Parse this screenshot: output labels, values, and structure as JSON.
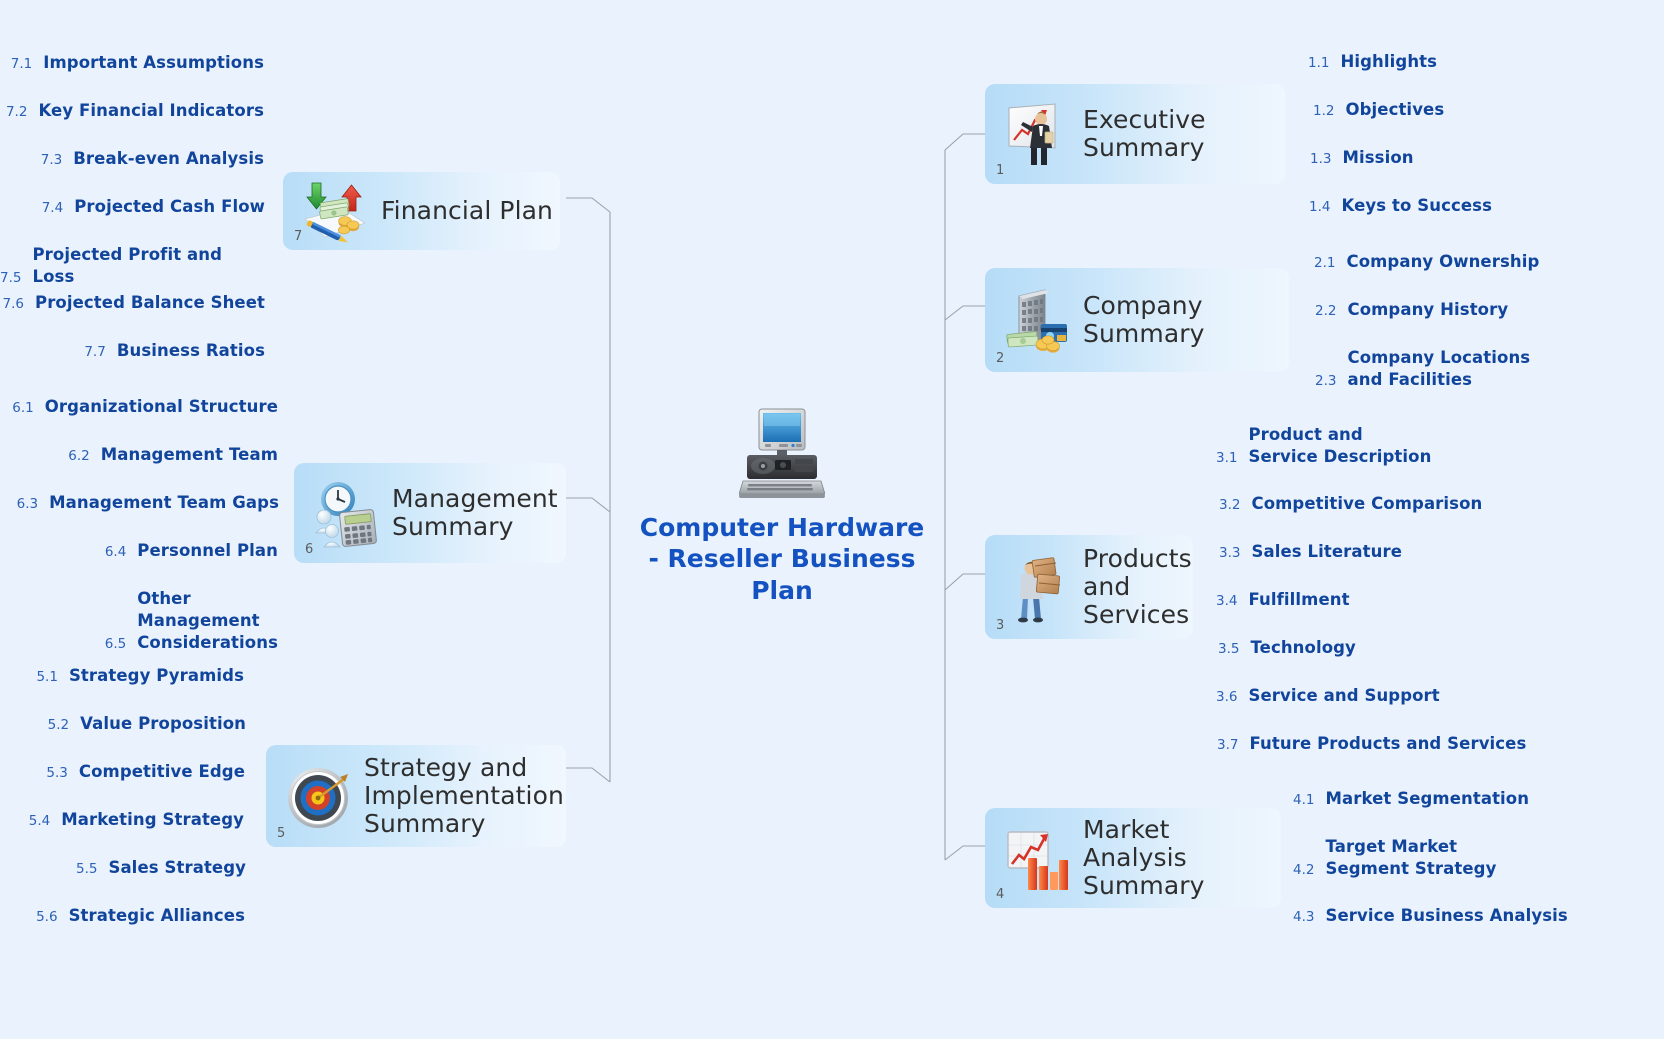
{
  "central": {
    "title": "Computer Hardware - Reseller Business Plan",
    "icon": "desktop-computer-icon"
  },
  "theme": {
    "background": "#eaf2fd",
    "central_title_color": "#1352c0",
    "node_label_color": "#2e2e2e",
    "subtopic_text_color": "#11459c",
    "subtopic_number_color": "#2d62b8",
    "connector_color": "#9aa2ab",
    "node_gradient_start": "#b5dcf7",
    "node_gradient_end": "#eef6fe"
  },
  "branches": [
    {
      "number": "1",
      "label": "Executive Summary",
      "icon": "presenter-chart-icon",
      "side": "right",
      "subtopics": [
        {
          "number": "1.1",
          "label": "Highlights"
        },
        {
          "number": "1.2",
          "label": "Objectives"
        },
        {
          "number": "1.3",
          "label": "Mission"
        },
        {
          "number": "1.4",
          "label": "Keys to Success"
        }
      ]
    },
    {
      "number": "2",
      "label": "Company Summary",
      "icon": "office-building-money-icon",
      "side": "right",
      "subtopics": [
        {
          "number": "2.1",
          "label": "Company Ownership"
        },
        {
          "number": "2.2",
          "label": "Company History"
        },
        {
          "number": "2.3",
          "label": "Company Locations and Facilities"
        }
      ]
    },
    {
      "number": "3",
      "label": "Products and Services",
      "icon": "person-carrying-boxes-icon",
      "side": "right",
      "subtopics": [
        {
          "number": "3.1",
          "label": "Product and Service Description"
        },
        {
          "number": "3.2",
          "label": "Competitive Comparison"
        },
        {
          "number": "3.3",
          "label": "Sales Literature"
        },
        {
          "number": "3.4",
          "label": "Fulfillment"
        },
        {
          "number": "3.5",
          "label": "Technology"
        },
        {
          "number": "3.6",
          "label": "Service and Support"
        },
        {
          "number": "3.7",
          "label": "Future Products and Services"
        }
      ]
    },
    {
      "number": "4",
      "label": "Market Analysis Summary",
      "icon": "bar-chart-growth-icon",
      "side": "right",
      "subtopics": [
        {
          "number": "4.1",
          "label": "Market Segmentation"
        },
        {
          "number": "4.2",
          "label": "Target Market Segment Strategy"
        },
        {
          "number": "4.3",
          "label": "Service Business Analysis"
        }
      ]
    },
    {
      "number": "5",
      "label": "Strategy and Implementation Summary",
      "icon": "dartboard-target-icon",
      "side": "left",
      "subtopics": [
        {
          "number": "5.1",
          "label": "Strategy Pyramids"
        },
        {
          "number": "5.2",
          "label": "Value Proposition"
        },
        {
          "number": "5.3",
          "label": "Competitive Edge"
        },
        {
          "number": "5.4",
          "label": "Marketing Strategy"
        },
        {
          "number": "5.5",
          "label": "Sales Strategy"
        },
        {
          "number": "5.6",
          "label": "Strategic Alliances"
        }
      ]
    },
    {
      "number": "6",
      "label": "Management Summary",
      "icon": "clock-calculator-people-icon",
      "side": "left",
      "subtopics": [
        {
          "number": "6.1",
          "label": "Organizational Structure"
        },
        {
          "number": "6.2",
          "label": "Management Team"
        },
        {
          "number": "6.3",
          "label": "Management Team Gaps"
        },
        {
          "number": "6.4",
          "label": "Personnel Plan"
        },
        {
          "number": "6.5",
          "label": "Other Management Considerations"
        }
      ]
    },
    {
      "number": "7",
      "label": "Financial Plan",
      "icon": "money-arrows-pen-icon",
      "side": "left",
      "subtopics": [
        {
          "number": "7.1",
          "label": "Important Assumptions"
        },
        {
          "number": "7.2",
          "label": "Key Financial Indicators"
        },
        {
          "number": "7.3",
          "label": "Break-even Analysis"
        },
        {
          "number": "7.4",
          "label": "Projected Cash Flow"
        },
        {
          "number": "7.5",
          "label": "Projected Profit and Loss"
        },
        {
          "number": "7.6",
          "label": "Projected Balance Sheet"
        },
        {
          "number": "7.7",
          "label": "Business Ratios"
        }
      ]
    }
  ]
}
